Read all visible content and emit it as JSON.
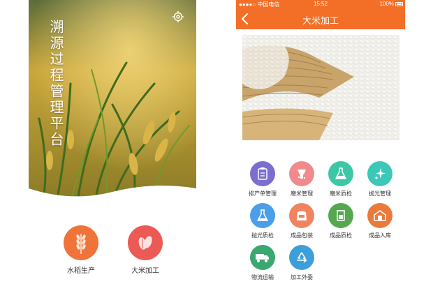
{
  "left": {
    "title": "溯源过程管理平台",
    "modules": [
      {
        "label": "水稻生产",
        "icon": "rice-stalk-icon",
        "color": "#f0733a"
      },
      {
        "label": "大米加工",
        "icon": "rice-grain-icon",
        "color": "#ec5a55"
      }
    ]
  },
  "right": {
    "status_bar": {
      "carrier": "●●●●○ 中国电信",
      "time": "15:52",
      "battery": "100%"
    },
    "nav": {
      "title": "大米加工",
      "back_icon": "back-arrow-icon"
    },
    "accent_color": "#f36e26",
    "functions": [
      {
        "label": "排产单管理",
        "icon": "clipboard-icon",
        "color": "#7a6fcf"
      },
      {
        "label": "磨米管理",
        "icon": "grinder-icon",
        "color": "#f08a8d"
      },
      {
        "label": "磨米质检",
        "icon": "flask-icon",
        "color": "#3cc7a6"
      },
      {
        "label": "抛光管理",
        "icon": "sparkle-icon",
        "color": "#3cc7b8"
      },
      {
        "label": "抛光质检",
        "icon": "beaker-icon",
        "color": "#4b9ee8"
      },
      {
        "label": "成品包装",
        "icon": "package-bag-icon",
        "color": "#f0845f"
      },
      {
        "label": "成品质检",
        "icon": "test-tube-icon",
        "color": "#55a84f"
      },
      {
        "label": "成品入库",
        "icon": "warehouse-icon",
        "color": "#ea7a3c"
      },
      {
        "label": "物流运输",
        "icon": "truck-icon",
        "color": "#3aa870"
      },
      {
        "label": "加工外委",
        "icon": "recycle-icon",
        "color": "#3d9fd9"
      }
    ]
  }
}
